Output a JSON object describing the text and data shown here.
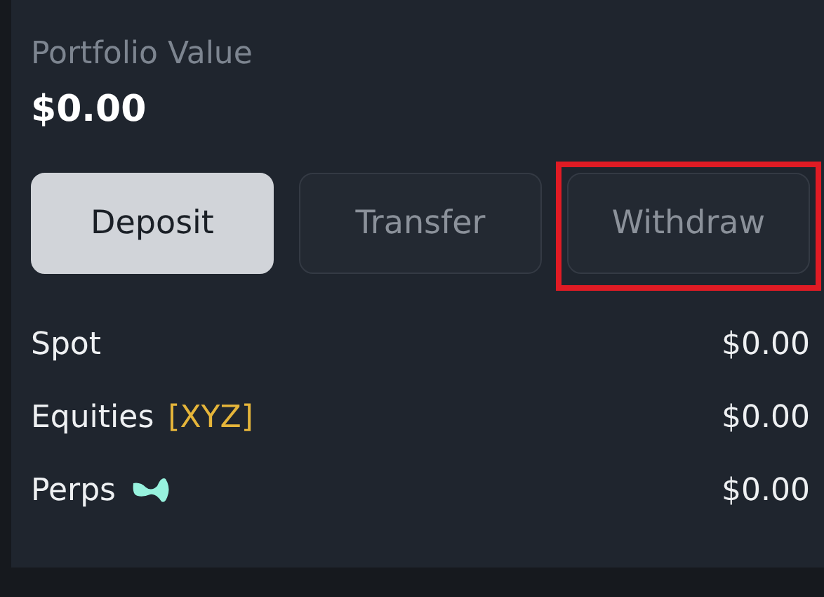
{
  "title": "Portfolio Value",
  "total": "$0.00",
  "buttons": [
    {
      "label": "Deposit",
      "kind": "primary",
      "highlighted": false
    },
    {
      "label": "Transfer",
      "kind": "secondary",
      "highlighted": false
    },
    {
      "label": "Withdraw",
      "kind": "secondary",
      "highlighted": true
    }
  ],
  "rows": [
    {
      "kind": "plain",
      "label": "Spot",
      "value": "$0.00"
    },
    {
      "kind": "tagged",
      "label": "Equities",
      "tag": "[XYZ]",
      "value": "$0.00"
    },
    {
      "kind": "icon",
      "label": "Perps",
      "value": "$0.00"
    }
  ]
}
